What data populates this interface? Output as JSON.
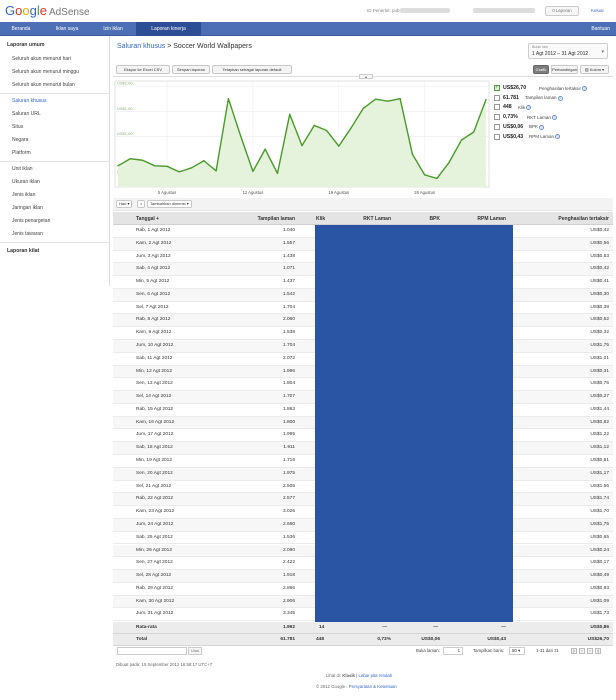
{
  "header": {
    "logo_google": "Google",
    "logo_product": "AdSense",
    "publisher_label": "ID Penerbit: pub-",
    "messages_label": "0 Laporan",
    "logout_label": "Keluar"
  },
  "nav": {
    "tabs": [
      "Beranda",
      "Iklan saya",
      "Izin iklan",
      "Laporan kinerja"
    ],
    "active_tab": "Laporan kinerja",
    "help": "Bantuan"
  },
  "sidebar": {
    "general_head": "Laporan umum",
    "general_items": [
      "Seluruh akun menurut hari",
      "Seluruh akun menurut minggu",
      "Seluruh akun menurut bulan"
    ],
    "channels": [
      "Saluran khusus",
      "Saluran URL",
      "Situs",
      "Negara",
      "Platform"
    ],
    "units": [
      "Unit iklan",
      "Ukuran iklan",
      "Jenis iklan",
      "Jaringan iklan",
      "Jenis penargetan",
      "Jenis tawaran"
    ],
    "quick_head": "Laporan kilat"
  },
  "report": {
    "breadcrumb_link": "Saluran khusus",
    "breadcrumb_sep": ">",
    "breadcrumb_current": "Soccer World Wallpapers",
    "date_label": "Bulan lalu",
    "date_range": "1 Agt 2012 – 31 Agt 2012",
    "buttons": [
      "Ekspor ke Excel CSV",
      "Simpan laporan",
      "Tetapkan sebagai laporan default"
    ],
    "view_buttons": [
      "Grafik",
      "Perbandingan",
      "Kolom"
    ],
    "active_view": "Grafik",
    "dim_buttons": [
      "Hari",
      "×",
      "Tambahkan dimensi"
    ]
  },
  "legend": [
    {
      "value": "US$26,70",
      "name": "Penghasilan tertaksir",
      "checked": true
    },
    {
      "value": "61.781",
      "name": "Tampilan laman",
      "checked": false
    },
    {
      "value": "448",
      "name": "Klik",
      "checked": false
    },
    {
      "value": "0,73%",
      "name": "RKT Laman",
      "checked": false
    },
    {
      "value": "US$0,06",
      "name": "BPK",
      "checked": false
    },
    {
      "value": "US$0,43",
      "name": "RPM Laman",
      "checked": false
    }
  ],
  "chart_data": {
    "type": "area",
    "ylabel_ticks": [
      "US$0,25",
      "US$1,00",
      "US$1,50",
      "US$2,00"
    ],
    "y_ticks": [
      0.25,
      1.0,
      1.5,
      2.0
    ],
    "x_tick_labels": [
      "5 Agustus",
      "12 Agustus",
      "19 Agustus",
      "26 Agustus"
    ],
    "x_tick_days": [
      5,
      12,
      19,
      26
    ],
    "ylim": [
      0,
      2.1
    ],
    "line_color": "#4a9a2a",
    "fill_color": "#e5f2dc",
    "x": [
      1,
      2,
      3,
      4,
      5,
      6,
      7,
      8,
      9,
      10,
      11,
      12,
      13,
      14,
      15,
      16,
      17,
      18,
      19,
      20,
      21,
      22,
      23,
      24,
      25,
      26,
      27,
      28,
      29,
      30,
      31
    ],
    "values": [
      0.42,
      0.56,
      0.53,
      0.42,
      0.41,
      0.3,
      0.38,
      0.52,
      0.32,
      1.75,
      1.01,
      0.31,
      0.75,
      0.27,
      1.44,
      0.82,
      1.22,
      1.12,
      0.81,
      1.17,
      1.56,
      1.74,
      1.7,
      1.75,
      0.65,
      0.24,
      0.17,
      0.49,
      0.93,
      1.09,
      1.73
    ]
  },
  "table": {
    "columns": [
      "Tanggal",
      "Tampilan laman",
      "Klik",
      "RKT Laman",
      "BPK",
      "RPM Laman",
      "Penghasilan tertaksir"
    ],
    "rows": [
      [
        "Rab, 1 Agt 2012",
        "1.040",
        "US$0,42"
      ],
      [
        "Kam, 2 Agt 2012",
        "1.557",
        "US$0,56"
      ],
      [
        "Jum, 3 Agt 2012",
        "1.438",
        "US$0,53"
      ],
      [
        "Sab, 4 Agt 2012",
        "1.071",
        "US$0,42"
      ],
      [
        "Min, 5 Agt 2012",
        "1.437",
        "US$0,41"
      ],
      [
        "Sen, 6 Agt 2012",
        "1.542",
        "US$0,30"
      ],
      [
        "Sel, 7 Agt 2012",
        "1.704",
        "US$0,38"
      ],
      [
        "Rab, 8 Agt 2012",
        "2.060",
        "US$0,52"
      ],
      [
        "Kam, 9 Agt 2012",
        "1.538",
        "US$0,32"
      ],
      [
        "Jum, 10 Agt 2012",
        "1.704",
        "US$1,75"
      ],
      [
        "Sab, 11 Agt 2012",
        "2.072",
        "US$1,01"
      ],
      [
        "Min, 12 Agt 2012",
        "1.996",
        "US$0,31"
      ],
      [
        "Sen, 13 Agt 2012",
        "1.804",
        "US$0,75"
      ],
      [
        "Sel, 14 Agt 2012",
        "1.707",
        "US$0,27"
      ],
      [
        "Rab, 15 Agt 2012",
        "1.863",
        "US$1,44"
      ],
      [
        "Kam, 16 Agt 2012",
        "1.800",
        "US$0,82"
      ],
      [
        "Jum, 17 Agt 2012",
        "1.995",
        "US$1,22"
      ],
      [
        "Sab, 18 Agt 2012",
        "1.911",
        "US$1,12"
      ],
      [
        "Min, 19 Agt 2012",
        "1.716",
        "US$0,81"
      ],
      [
        "Sen, 20 Agt 2012",
        "1.975",
        "US$1,17"
      ],
      [
        "Sel, 21 Agt 2012",
        "2.505",
        "US$1,56"
      ],
      [
        "Rab, 22 Agt 2012",
        "2.577",
        "US$1,74"
      ],
      [
        "Kam, 23 Agt 2012",
        "3.026",
        "US$1,70"
      ],
      [
        "Jum, 24 Agt 2012",
        "2.660",
        "US$1,75"
      ],
      [
        "Sab, 25 Agt 2012",
        "1.536",
        "US$0,65"
      ],
      [
        "Min, 26 Agt 2012",
        "2.090",
        "US$0,24"
      ],
      [
        "Sen, 27 Agt 2012",
        "2.422",
        "US$0,17"
      ],
      [
        "Sel, 28 Agt 2012",
        "1.918",
        "US$0,49"
      ],
      [
        "Rab, 29 Agt 2012",
        "2.866",
        "US$0,93"
      ],
      [
        "Kam, 30 Agt 2012",
        "2.906",
        "US$1,09"
      ],
      [
        "Jum, 31 Agt 2012",
        "3.345",
        "US$1,73"
      ]
    ],
    "average": {
      "label": "Rata-rata",
      "views": "1.992",
      "clicks": "14",
      "ctr": "—",
      "cpc": "—",
      "rpm": "—",
      "earn": "US$0,86"
    },
    "total": {
      "label": "Total",
      "views": "61.781",
      "clicks": "448",
      "ctr": "0,73%",
      "cpc": "US$0,06",
      "rpm": "US$0,43",
      "earn": "US$26,70"
    }
  },
  "pager": {
    "filter_button": "Ulas",
    "jump_label": "Buka laman:",
    "jump_value": "1",
    "rows_label": "Tampilkan baris:",
    "rows_value": "50",
    "range": "1-31 dari 31"
  },
  "footer": {
    "generated": "Dibuat pada: 19 September 2012 16:58:17 UTC+7",
    "view_label": "Lihat di:",
    "view_current": "Klasik",
    "view_other": "Lebar pita rendah",
    "copyright": "© 2012 Google",
    "terms": "Persyaratan & Ketentuan"
  }
}
